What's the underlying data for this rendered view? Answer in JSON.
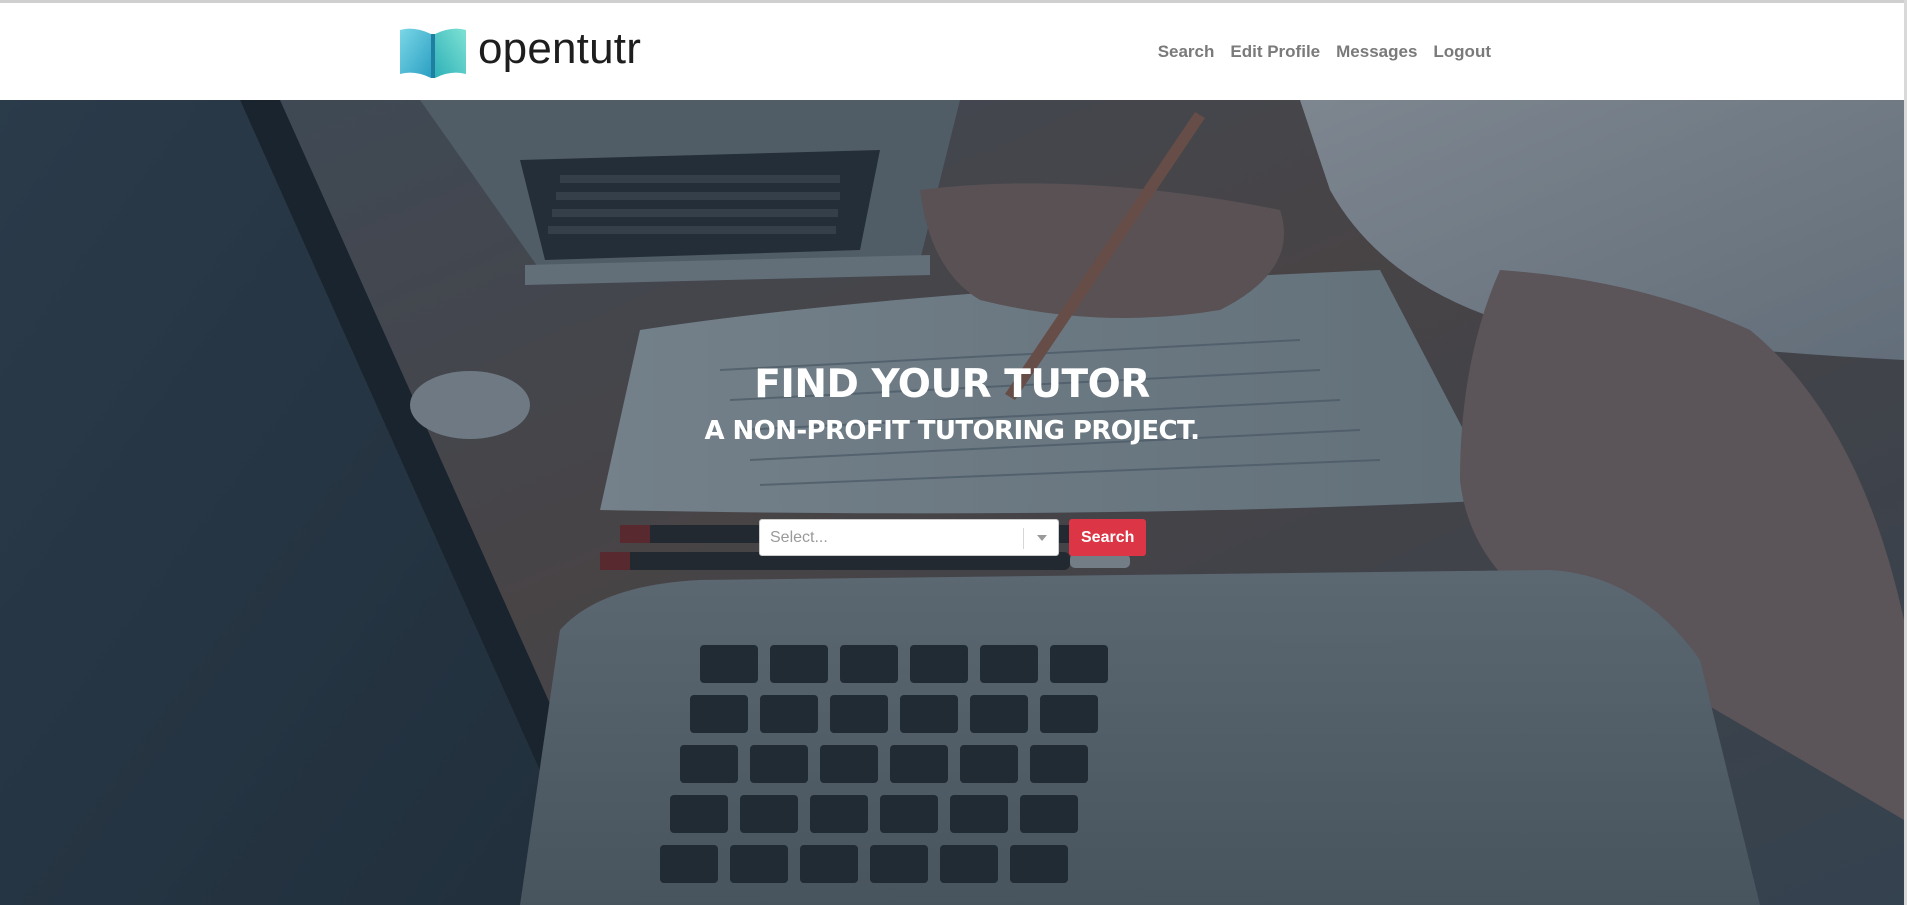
{
  "brand": {
    "name": "opentutr",
    "logo_icon": "open-book-icon",
    "logo_colors": [
      "#3db8c9",
      "#2fa7c2",
      "#6fd3cf"
    ]
  },
  "nav": {
    "items": [
      {
        "label": "Search"
      },
      {
        "label": "Edit Profile"
      },
      {
        "label": "Messages"
      },
      {
        "label": "Logout"
      }
    ]
  },
  "hero": {
    "title": "FIND YOUR TUTOR",
    "subtitle": "A NON-PROFIT TUTORING PROJECT.",
    "background_image": "photo-laptops-and-hands-on-desk"
  },
  "search": {
    "select_placeholder": "Select...",
    "button_label": "Search",
    "button_color": "#dc3545"
  },
  "colors": {
    "nav_text": "#7a7a7a",
    "brand_text": "#1e1e1e",
    "hero_overlay": "#162636"
  }
}
